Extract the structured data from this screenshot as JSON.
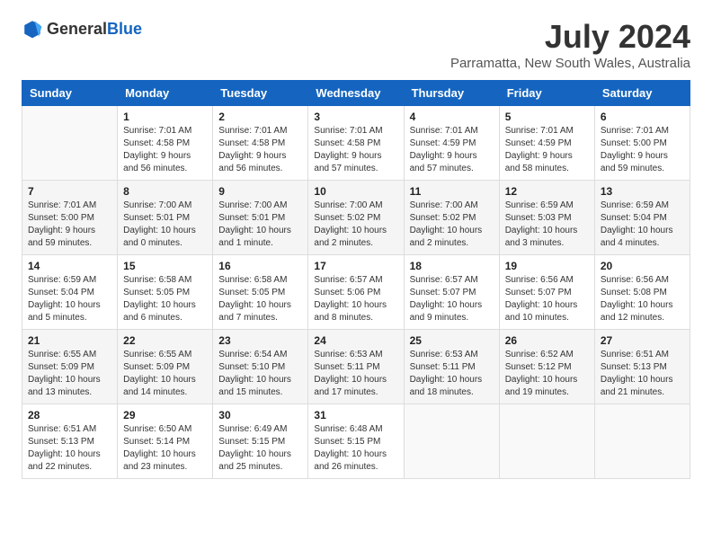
{
  "header": {
    "logo_general": "General",
    "logo_blue": "Blue",
    "month_year": "July 2024",
    "location": "Parramatta, New South Wales, Australia"
  },
  "weekdays": [
    "Sunday",
    "Monday",
    "Tuesday",
    "Wednesday",
    "Thursday",
    "Friday",
    "Saturday"
  ],
  "weeks": [
    [
      {
        "day": "",
        "info": ""
      },
      {
        "day": "1",
        "info": "Sunrise: 7:01 AM\nSunset: 4:58 PM\nDaylight: 9 hours\nand 56 minutes."
      },
      {
        "day": "2",
        "info": "Sunrise: 7:01 AM\nSunset: 4:58 PM\nDaylight: 9 hours\nand 56 minutes."
      },
      {
        "day": "3",
        "info": "Sunrise: 7:01 AM\nSunset: 4:58 PM\nDaylight: 9 hours\nand 57 minutes."
      },
      {
        "day": "4",
        "info": "Sunrise: 7:01 AM\nSunset: 4:59 PM\nDaylight: 9 hours\nand 57 minutes."
      },
      {
        "day": "5",
        "info": "Sunrise: 7:01 AM\nSunset: 4:59 PM\nDaylight: 9 hours\nand 58 minutes."
      },
      {
        "day": "6",
        "info": "Sunrise: 7:01 AM\nSunset: 5:00 PM\nDaylight: 9 hours\nand 59 minutes."
      }
    ],
    [
      {
        "day": "7",
        "info": "Sunrise: 7:01 AM\nSunset: 5:00 PM\nDaylight: 9 hours\nand 59 minutes."
      },
      {
        "day": "8",
        "info": "Sunrise: 7:00 AM\nSunset: 5:01 PM\nDaylight: 10 hours\nand 0 minutes."
      },
      {
        "day": "9",
        "info": "Sunrise: 7:00 AM\nSunset: 5:01 PM\nDaylight: 10 hours\nand 1 minute."
      },
      {
        "day": "10",
        "info": "Sunrise: 7:00 AM\nSunset: 5:02 PM\nDaylight: 10 hours\nand 2 minutes."
      },
      {
        "day": "11",
        "info": "Sunrise: 7:00 AM\nSunset: 5:02 PM\nDaylight: 10 hours\nand 2 minutes."
      },
      {
        "day": "12",
        "info": "Sunrise: 6:59 AM\nSunset: 5:03 PM\nDaylight: 10 hours\nand 3 minutes."
      },
      {
        "day": "13",
        "info": "Sunrise: 6:59 AM\nSunset: 5:04 PM\nDaylight: 10 hours\nand 4 minutes."
      }
    ],
    [
      {
        "day": "14",
        "info": "Sunrise: 6:59 AM\nSunset: 5:04 PM\nDaylight: 10 hours\nand 5 minutes."
      },
      {
        "day": "15",
        "info": "Sunrise: 6:58 AM\nSunset: 5:05 PM\nDaylight: 10 hours\nand 6 minutes."
      },
      {
        "day": "16",
        "info": "Sunrise: 6:58 AM\nSunset: 5:05 PM\nDaylight: 10 hours\nand 7 minutes."
      },
      {
        "day": "17",
        "info": "Sunrise: 6:57 AM\nSunset: 5:06 PM\nDaylight: 10 hours\nand 8 minutes."
      },
      {
        "day": "18",
        "info": "Sunrise: 6:57 AM\nSunset: 5:07 PM\nDaylight: 10 hours\nand 9 minutes."
      },
      {
        "day": "19",
        "info": "Sunrise: 6:56 AM\nSunset: 5:07 PM\nDaylight: 10 hours\nand 10 minutes."
      },
      {
        "day": "20",
        "info": "Sunrise: 6:56 AM\nSunset: 5:08 PM\nDaylight: 10 hours\nand 12 minutes."
      }
    ],
    [
      {
        "day": "21",
        "info": "Sunrise: 6:55 AM\nSunset: 5:09 PM\nDaylight: 10 hours\nand 13 minutes."
      },
      {
        "day": "22",
        "info": "Sunrise: 6:55 AM\nSunset: 5:09 PM\nDaylight: 10 hours\nand 14 minutes."
      },
      {
        "day": "23",
        "info": "Sunrise: 6:54 AM\nSunset: 5:10 PM\nDaylight: 10 hours\nand 15 minutes."
      },
      {
        "day": "24",
        "info": "Sunrise: 6:53 AM\nSunset: 5:11 PM\nDaylight: 10 hours\nand 17 minutes."
      },
      {
        "day": "25",
        "info": "Sunrise: 6:53 AM\nSunset: 5:11 PM\nDaylight: 10 hours\nand 18 minutes."
      },
      {
        "day": "26",
        "info": "Sunrise: 6:52 AM\nSunset: 5:12 PM\nDaylight: 10 hours\nand 19 minutes."
      },
      {
        "day": "27",
        "info": "Sunrise: 6:51 AM\nSunset: 5:13 PM\nDaylight: 10 hours\nand 21 minutes."
      }
    ],
    [
      {
        "day": "28",
        "info": "Sunrise: 6:51 AM\nSunset: 5:13 PM\nDaylight: 10 hours\nand 22 minutes."
      },
      {
        "day": "29",
        "info": "Sunrise: 6:50 AM\nSunset: 5:14 PM\nDaylight: 10 hours\nand 23 minutes."
      },
      {
        "day": "30",
        "info": "Sunrise: 6:49 AM\nSunset: 5:15 PM\nDaylight: 10 hours\nand 25 minutes."
      },
      {
        "day": "31",
        "info": "Sunrise: 6:48 AM\nSunset: 5:15 PM\nDaylight: 10 hours\nand 26 minutes."
      },
      {
        "day": "",
        "info": ""
      },
      {
        "day": "",
        "info": ""
      },
      {
        "day": "",
        "info": ""
      }
    ]
  ]
}
